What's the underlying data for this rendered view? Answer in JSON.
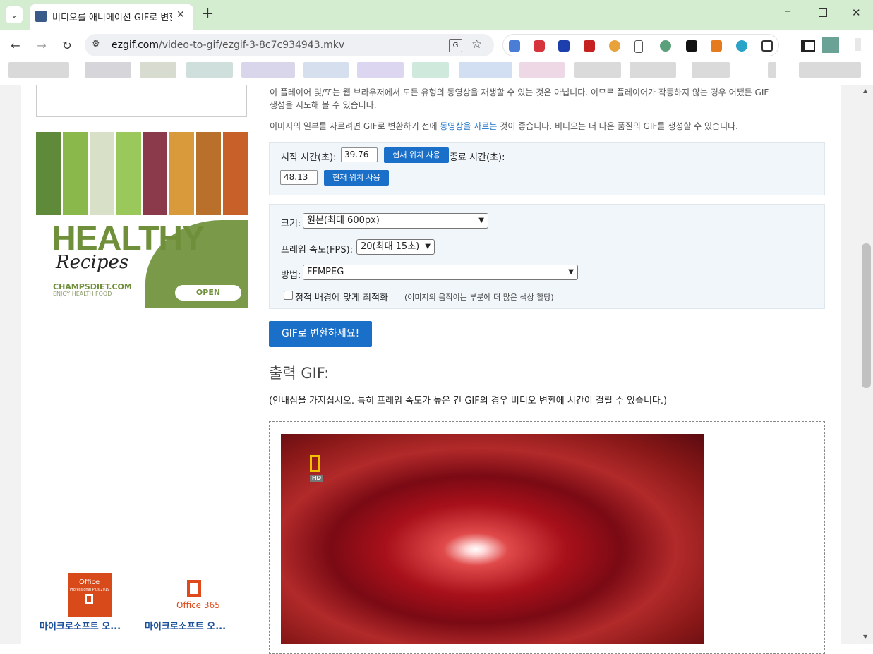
{
  "browser": {
    "tab_title": "비디오를 애니메이션 GIF로 변환",
    "new_tab_symbol": "+",
    "url_host": "ezgif.com",
    "url_path": "/video-to-gif/ezgif-3-8c7c934943.mkv"
  },
  "intro": {
    "line1": "이 플레이어 및/또는 웹 브라우저에서 모든 유형의 동영상을 재생할 수 있는 것은 아닙니다. 이므로 플레이어가 작동하지 않는 경우 어쨌든 GIF",
    "line2": "생성을 시도해 볼 수 있습니다.",
    "crop_prefix": "이미지의 일부를 자르려면 GIF로 변환하기 전에 ",
    "crop_link": "동영상을 자르는",
    "crop_suffix": " 것이 좋습니다. 비디오는 더 나은 품질의 GIF를 생성할 수 있습니다."
  },
  "time_panel": {
    "start_label": "시작 시간(초):",
    "start_value": "39.76",
    "use_current": "현재 위치 사용",
    "end_label": "종료 시간(초):",
    "end_value": "48.13"
  },
  "options": {
    "size_label": "크기:",
    "size_value": "원본(최대 600px)",
    "fps_label": "프레임 속도(FPS):",
    "fps_value": "20(최대 15초)",
    "method_label": "방법:",
    "method_value": "FFMPEG",
    "optimize_label": "정적 배경에 맞게 최적화",
    "optimize_note": "(이미지의 움직이는 부분에 더 많은 색상 할당)",
    "optimize_checked": false
  },
  "convert_button": "GIF로 변환하세요!",
  "output": {
    "heading": "출력 GIF:",
    "note": "(인내심을 가지십시오. 특히 프레임 속도가 높은 긴 GIF의 경우 비디오 변환에 시간이 걸릴 수 있습니다.)",
    "badge_text": "HD"
  },
  "ad": {
    "title": "HEALTHY",
    "script": "Recipes",
    "site": "CHAMPSDIET.COM",
    "tagline": "ENJOY HEALTH FOOD",
    "button": "OPEN"
  },
  "products": [
    {
      "label": "마이크로소프트 오...",
      "box_text": "Office",
      "box_sub": "Professional Plus 2019"
    },
    {
      "label": "마이크로소프트 오...",
      "box_text": "Office 365"
    }
  ],
  "colors": {
    "accent": "#1a6fc9",
    "tabstrip": "#d4ecd0",
    "panel": "#f1f6fb",
    "ad_green": "#7a9a4a"
  }
}
